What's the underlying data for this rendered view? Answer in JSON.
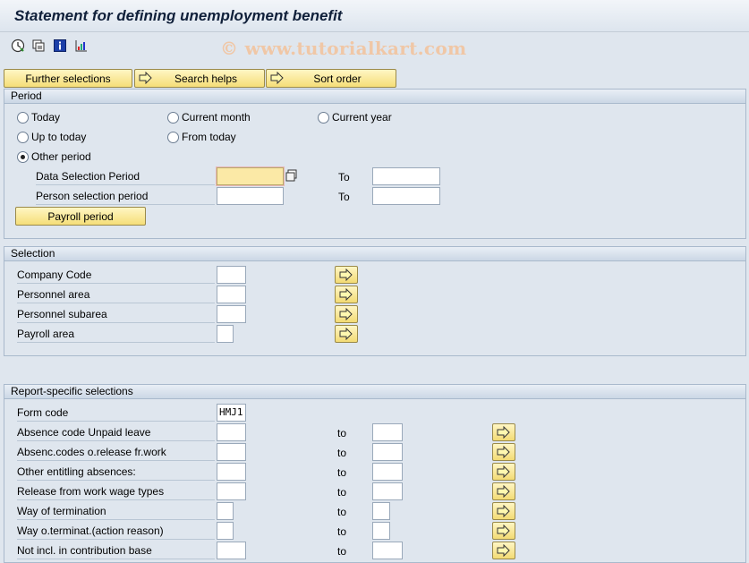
{
  "window": {
    "title": "Statement for defining unemployment benefit"
  },
  "watermark": "© www.tutorialkart.com",
  "toolbar": {
    "icons": [
      "execute-icon",
      "get-variant-icon",
      "info-icon",
      "selection-options-icon"
    ]
  },
  "buttons": {
    "further_selections": "Further selections",
    "search_helps": "Search helps",
    "sort_order": "Sort order",
    "payroll_period": "Payroll period"
  },
  "period": {
    "header": "Period",
    "radios": {
      "today": "Today",
      "current_month": "Current month",
      "current_year": "Current year",
      "up_to_today": "Up to today",
      "from_today": "From today",
      "other_period": "Other period"
    },
    "selected": "other_period",
    "data_selection_label": "Data Selection Period",
    "person_selection_label": "Person selection period",
    "to_label": "To",
    "data_from": "",
    "data_to": "",
    "person_from": "",
    "person_to": ""
  },
  "selection": {
    "header": "Selection",
    "rows": [
      {
        "label": "Company Code",
        "value": ""
      },
      {
        "label": "Personnel area",
        "value": ""
      },
      {
        "label": "Personnel subarea",
        "value": ""
      },
      {
        "label": "Payroll area",
        "value": ""
      }
    ]
  },
  "report": {
    "header": "Report-specific selections",
    "form_code_label": "Form code",
    "form_code_value": "HMJ1",
    "to_label": "to",
    "rows": [
      {
        "label": "Absence code Unpaid leave",
        "from": "",
        "to": ""
      },
      {
        "label": "Absenc.codes o.release fr.work",
        "from": "",
        "to": ""
      },
      {
        "label": "Other entitling absences:",
        "from": "",
        "to": ""
      },
      {
        "label": "Release from work wage types",
        "from": "",
        "to": ""
      },
      {
        "label": "Way of termination",
        "from": "",
        "to": ""
      },
      {
        "label": "Way o.terminat.(action reason)",
        "from": "",
        "to": ""
      },
      {
        "label": "Not incl. in contribution base",
        "from": "",
        "to": ""
      }
    ]
  }
}
